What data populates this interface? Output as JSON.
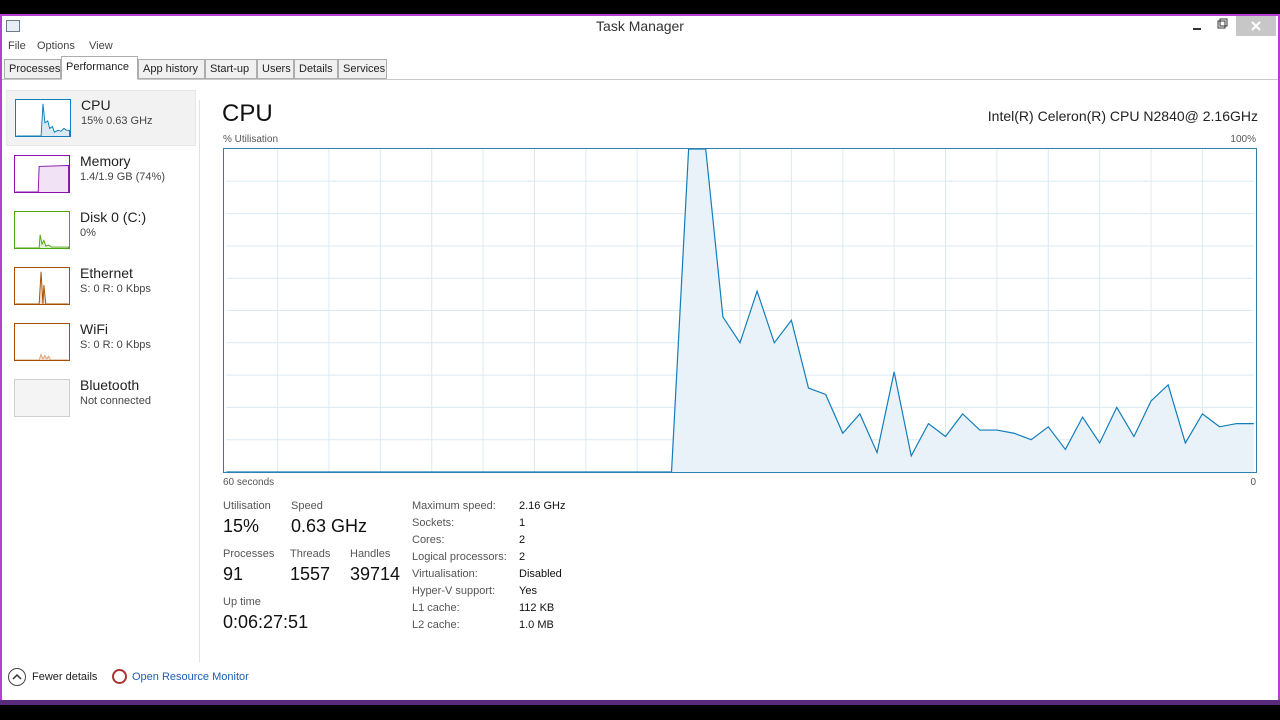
{
  "window": {
    "title": "Task Manager"
  },
  "menu": [
    "File",
    "Options",
    "View"
  ],
  "tabs": [
    "Processes",
    "Performance",
    "App history",
    "Start-up",
    "Users",
    "Details",
    "Services"
  ],
  "active_tab": "Performance",
  "sidebar": [
    {
      "name": "CPU",
      "sub": "15%  0.63 GHz",
      "color": "#117dbb"
    },
    {
      "name": "Memory",
      "sub": "1.4/1.9 GB (74%)",
      "color": "#8b12ae"
    },
    {
      "name": "Disk 0 (C:)",
      "sub": "0%",
      "color": "#4da60c"
    },
    {
      "name": "Ethernet",
      "sub": "S: 0  R: 0 Kbps",
      "color": "#a74f01"
    },
    {
      "name": "WiFi",
      "sub": "S: 0  R: 0 Kbps",
      "color": "#a74f01"
    },
    {
      "name": "Bluetooth",
      "sub": "Not connected",
      "color": "#999999"
    }
  ],
  "main": {
    "title": "CPU",
    "model": "Intel(R) Celeron(R) CPU N2840@ 2.16GHz",
    "util_label": "% Utilisation",
    "util_max": "100%",
    "axis_left": "60 seconds",
    "axis_right": "0"
  },
  "stats": {
    "utilisation_label": "Utilisation",
    "utilisation": "15%",
    "speed_label": "Speed",
    "speed": "0.63 GHz",
    "processes_label": "Processes",
    "processes": "91",
    "threads_label": "Threads",
    "threads": "1557",
    "handles_label": "Handles",
    "handles": "39714",
    "uptime_label": "Up time",
    "uptime": "0:06:27:51"
  },
  "specs": [
    {
      "label": "Maximum speed:",
      "value": "2.16 GHz"
    },
    {
      "label": "Sockets:",
      "value": "1"
    },
    {
      "label": "Cores:",
      "value": "2"
    },
    {
      "label": "Logical processors:",
      "value": "2"
    },
    {
      "label": "Virtualisation:",
      "value": "Disabled"
    },
    {
      "label": "Hyper-V support:",
      "value": "Yes"
    },
    {
      "label": "L1 cache:",
      "value": "112 KB"
    },
    {
      "label": "L2 cache:",
      "value": "1.0 MB"
    }
  ],
  "footer": {
    "fewer_details": "Fewer details",
    "resource_monitor": "Open Resource Monitor"
  },
  "chart_data": {
    "type": "area",
    "x": [
      60,
      59,
      58,
      57,
      56,
      55,
      54,
      53,
      52,
      51,
      50,
      49,
      48,
      47,
      46,
      45,
      44,
      43,
      42,
      41,
      40,
      39,
      38,
      37,
      36,
      35,
      34,
      33,
      32,
      31,
      30,
      29,
      28,
      27,
      26,
      25,
      24,
      23,
      22,
      21,
      20,
      19,
      18,
      17,
      16,
      15,
      14,
      13,
      12,
      11,
      10,
      9,
      8,
      7,
      6,
      5,
      4,
      3,
      2,
      1,
      0
    ],
    "series": [
      {
        "values": [
          0,
          0,
          0,
          0,
          0,
          0,
          0,
          0,
          0,
          0,
          0,
          0,
          0,
          0,
          0,
          0,
          0,
          0,
          0,
          0,
          0,
          0,
          0,
          0,
          0,
          0,
          0,
          100,
          100,
          48,
          40,
          56,
          40,
          47,
          26,
          24,
          12,
          18,
          6,
          31,
          5,
          15,
          11,
          18,
          13,
          13,
          12,
          10,
          14,
          7,
          17,
          9,
          20,
          11,
          22,
          27,
          9,
          18,
          14,
          15,
          15
        ],
        "color": "#117dbb"
      }
    ],
    "xlim": [
      60,
      0
    ],
    "ylim": [
      0,
      100
    ],
    "grid": true
  }
}
